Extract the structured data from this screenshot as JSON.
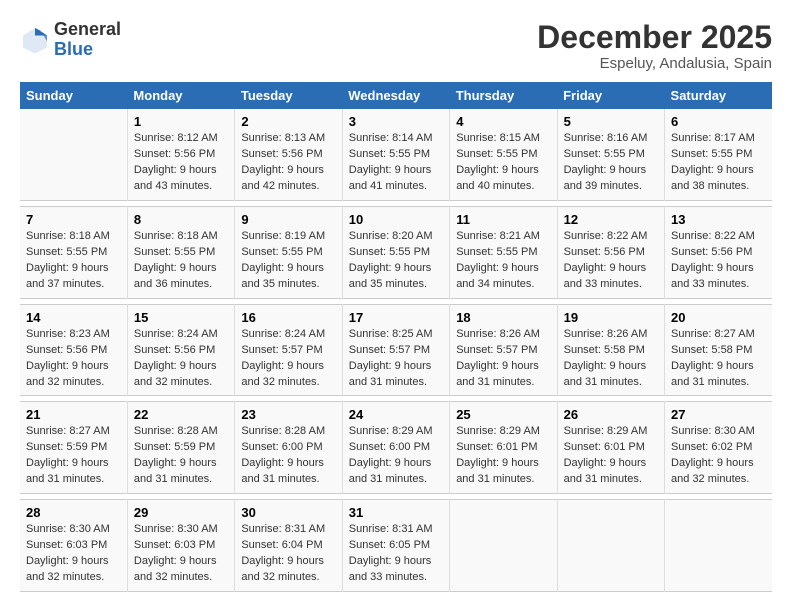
{
  "logo": {
    "line1": "General",
    "line2": "Blue"
  },
  "title": "December 2025",
  "subtitle": "Espeluy, Andalusia, Spain",
  "weekdays": [
    "Sunday",
    "Monday",
    "Tuesday",
    "Wednesday",
    "Thursday",
    "Friday",
    "Saturday"
  ],
  "rows": [
    [
      {
        "num": "",
        "info": ""
      },
      {
        "num": "1",
        "info": "Sunrise: 8:12 AM\nSunset: 5:56 PM\nDaylight: 9 hours\nand 43 minutes."
      },
      {
        "num": "2",
        "info": "Sunrise: 8:13 AM\nSunset: 5:56 PM\nDaylight: 9 hours\nand 42 minutes."
      },
      {
        "num": "3",
        "info": "Sunrise: 8:14 AM\nSunset: 5:55 PM\nDaylight: 9 hours\nand 41 minutes."
      },
      {
        "num": "4",
        "info": "Sunrise: 8:15 AM\nSunset: 5:55 PM\nDaylight: 9 hours\nand 40 minutes."
      },
      {
        "num": "5",
        "info": "Sunrise: 8:16 AM\nSunset: 5:55 PM\nDaylight: 9 hours\nand 39 minutes."
      },
      {
        "num": "6",
        "info": "Sunrise: 8:17 AM\nSunset: 5:55 PM\nDaylight: 9 hours\nand 38 minutes."
      }
    ],
    [
      {
        "num": "7",
        "info": "Sunrise: 8:18 AM\nSunset: 5:55 PM\nDaylight: 9 hours\nand 37 minutes."
      },
      {
        "num": "8",
        "info": "Sunrise: 8:18 AM\nSunset: 5:55 PM\nDaylight: 9 hours\nand 36 minutes."
      },
      {
        "num": "9",
        "info": "Sunrise: 8:19 AM\nSunset: 5:55 PM\nDaylight: 9 hours\nand 35 minutes."
      },
      {
        "num": "10",
        "info": "Sunrise: 8:20 AM\nSunset: 5:55 PM\nDaylight: 9 hours\nand 35 minutes."
      },
      {
        "num": "11",
        "info": "Sunrise: 8:21 AM\nSunset: 5:55 PM\nDaylight: 9 hours\nand 34 minutes."
      },
      {
        "num": "12",
        "info": "Sunrise: 8:22 AM\nSunset: 5:56 PM\nDaylight: 9 hours\nand 33 minutes."
      },
      {
        "num": "13",
        "info": "Sunrise: 8:22 AM\nSunset: 5:56 PM\nDaylight: 9 hours\nand 33 minutes."
      }
    ],
    [
      {
        "num": "14",
        "info": "Sunrise: 8:23 AM\nSunset: 5:56 PM\nDaylight: 9 hours\nand 32 minutes."
      },
      {
        "num": "15",
        "info": "Sunrise: 8:24 AM\nSunset: 5:56 PM\nDaylight: 9 hours\nand 32 minutes."
      },
      {
        "num": "16",
        "info": "Sunrise: 8:24 AM\nSunset: 5:57 PM\nDaylight: 9 hours\nand 32 minutes."
      },
      {
        "num": "17",
        "info": "Sunrise: 8:25 AM\nSunset: 5:57 PM\nDaylight: 9 hours\nand 31 minutes."
      },
      {
        "num": "18",
        "info": "Sunrise: 8:26 AM\nSunset: 5:57 PM\nDaylight: 9 hours\nand 31 minutes."
      },
      {
        "num": "19",
        "info": "Sunrise: 8:26 AM\nSunset: 5:58 PM\nDaylight: 9 hours\nand 31 minutes."
      },
      {
        "num": "20",
        "info": "Sunrise: 8:27 AM\nSunset: 5:58 PM\nDaylight: 9 hours\nand 31 minutes."
      }
    ],
    [
      {
        "num": "21",
        "info": "Sunrise: 8:27 AM\nSunset: 5:59 PM\nDaylight: 9 hours\nand 31 minutes."
      },
      {
        "num": "22",
        "info": "Sunrise: 8:28 AM\nSunset: 5:59 PM\nDaylight: 9 hours\nand 31 minutes."
      },
      {
        "num": "23",
        "info": "Sunrise: 8:28 AM\nSunset: 6:00 PM\nDaylight: 9 hours\nand 31 minutes."
      },
      {
        "num": "24",
        "info": "Sunrise: 8:29 AM\nSunset: 6:00 PM\nDaylight: 9 hours\nand 31 minutes."
      },
      {
        "num": "25",
        "info": "Sunrise: 8:29 AM\nSunset: 6:01 PM\nDaylight: 9 hours\nand 31 minutes."
      },
      {
        "num": "26",
        "info": "Sunrise: 8:29 AM\nSunset: 6:01 PM\nDaylight: 9 hours\nand 31 minutes."
      },
      {
        "num": "27",
        "info": "Sunrise: 8:30 AM\nSunset: 6:02 PM\nDaylight: 9 hours\nand 32 minutes."
      }
    ],
    [
      {
        "num": "28",
        "info": "Sunrise: 8:30 AM\nSunset: 6:03 PM\nDaylight: 9 hours\nand 32 minutes."
      },
      {
        "num": "29",
        "info": "Sunrise: 8:30 AM\nSunset: 6:03 PM\nDaylight: 9 hours\nand 32 minutes."
      },
      {
        "num": "30",
        "info": "Sunrise: 8:31 AM\nSunset: 6:04 PM\nDaylight: 9 hours\nand 32 minutes."
      },
      {
        "num": "31",
        "info": "Sunrise: 8:31 AM\nSunset: 6:05 PM\nDaylight: 9 hours\nand 33 minutes."
      },
      {
        "num": "",
        "info": ""
      },
      {
        "num": "",
        "info": ""
      },
      {
        "num": "",
        "info": ""
      }
    ]
  ]
}
